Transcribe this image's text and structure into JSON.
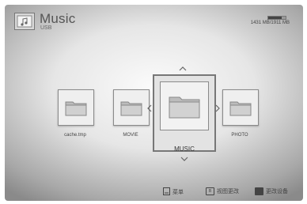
{
  "header": {
    "title": "Music",
    "subtitle": "USB",
    "icon": "music-folder-icon"
  },
  "storage": {
    "text": "1431 MB/1911 MB",
    "used_fraction": 0.75
  },
  "folders": [
    {
      "label": "cache.tmp",
      "icon": "folder-icon"
    },
    {
      "label": "MOVIE",
      "icon": "folder-icon"
    },
    {
      "label": "MUSIC",
      "icon": "folder-icon",
      "selected": true
    },
    {
      "label": "PHOTO",
      "icon": "folder-icon"
    }
  ],
  "footer": {
    "menu_label": "菜单",
    "view_label": "视图更改",
    "view_key": "B",
    "device_label": "更改设备"
  }
}
